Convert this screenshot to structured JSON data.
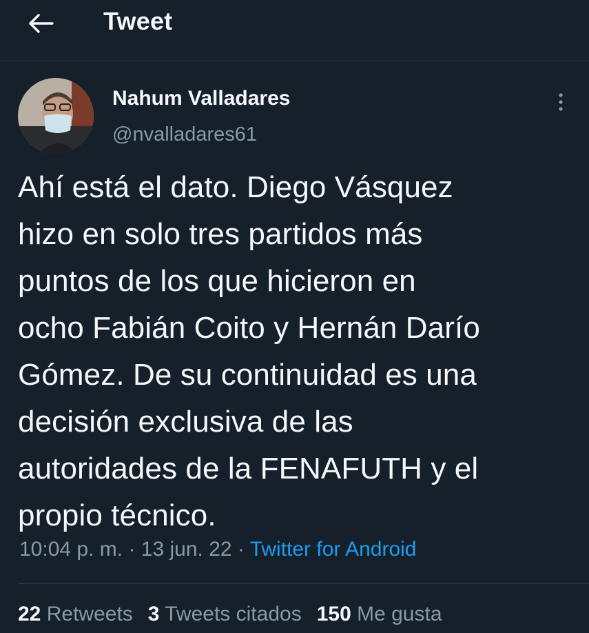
{
  "header": {
    "title": "Tweet",
    "back_icon": "arrow-left-icon"
  },
  "author": {
    "name": "Nahum Valladares",
    "handle": "@nvalladares61",
    "avatar_icon": "profile-photo"
  },
  "tweet": {
    "text": "Ahí está el dato. Diego Vásquez\nhizo en solo tres partidos más\npuntos de los que hicieron en\nocho Fabián Coito y Hernán Darío\nGómez. De su continuidad es una\ndecisión exclusiva de las\nautoridades de la FENAFUTH y el\npropio técnico.",
    "time": "10:04 p. m.",
    "separator": "·",
    "date": "13 jun. 22",
    "source": "Twitter for Android"
  },
  "stats": {
    "retweets_count": "22",
    "retweets_label": "Retweets",
    "quotes_count": "3",
    "quotes_label": "Tweets citados",
    "likes_count": "150",
    "likes_label": "Me gusta"
  },
  "colors": {
    "background": "#15202b",
    "accent": "#1d9bf0",
    "secondary_text": "#8b98a5"
  }
}
